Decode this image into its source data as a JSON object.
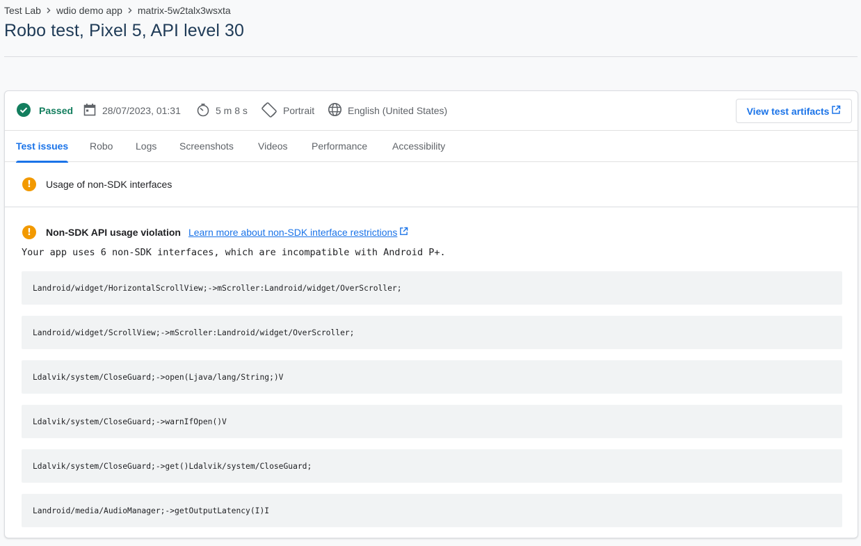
{
  "breadcrumb": {
    "items": [
      "Test Lab",
      "wdio demo app",
      "matrix-5w2talx3wsxta"
    ]
  },
  "page": {
    "title": "Robo test, Pixel 5, API level 30"
  },
  "summary": {
    "status": "Passed",
    "date": "28/07/2023, 01:31",
    "duration": "5 m 8 s",
    "orientation": "Portrait",
    "locale": "English (United States)",
    "artifacts_button": "View test artifacts"
  },
  "tabs": [
    {
      "label": "Test issues",
      "active": true
    },
    {
      "label": "Robo",
      "active": false
    },
    {
      "label": "Logs",
      "active": false
    },
    {
      "label": "Screenshots",
      "active": false
    },
    {
      "label": "Videos",
      "active": false
    },
    {
      "label": "Performance",
      "active": false
    },
    {
      "label": "Accessibility",
      "active": false
    }
  ],
  "issue": {
    "title": "Usage of non-SDK interfaces"
  },
  "detail": {
    "title": "Non-SDK API usage violation",
    "link_label": "Learn more about non-SDK interface restrictions",
    "description": "Your app uses 6 non-SDK interfaces, which are incompatible with Android P+.",
    "interfaces": [
      "Landroid/widget/HorizontalScrollView;->mScroller:Landroid/widget/OverScroller;",
      "Landroid/widget/ScrollView;->mScroller:Landroid/widget/OverScroller;",
      "Ldalvik/system/CloseGuard;->open(Ljava/lang/String;)V",
      "Ldalvik/system/CloseGuard;->warnIfOpen()V",
      "Ldalvik/system/CloseGuard;->get()Ldalvik/system/CloseGuard;",
      "Landroid/media/AudioManager;->getOutputLatency(I)I"
    ]
  },
  "colors": {
    "accent": "#1a73e8",
    "passed": "#137e5e",
    "warning": "#f29900"
  },
  "icons": {
    "status": "check-circle-icon",
    "date": "calendar-icon",
    "duration": "timer-icon",
    "orientation": "screen-rotation-icon",
    "locale": "globe-icon",
    "external": "open-in-new-icon",
    "warning": "exclamation-circle-icon"
  }
}
